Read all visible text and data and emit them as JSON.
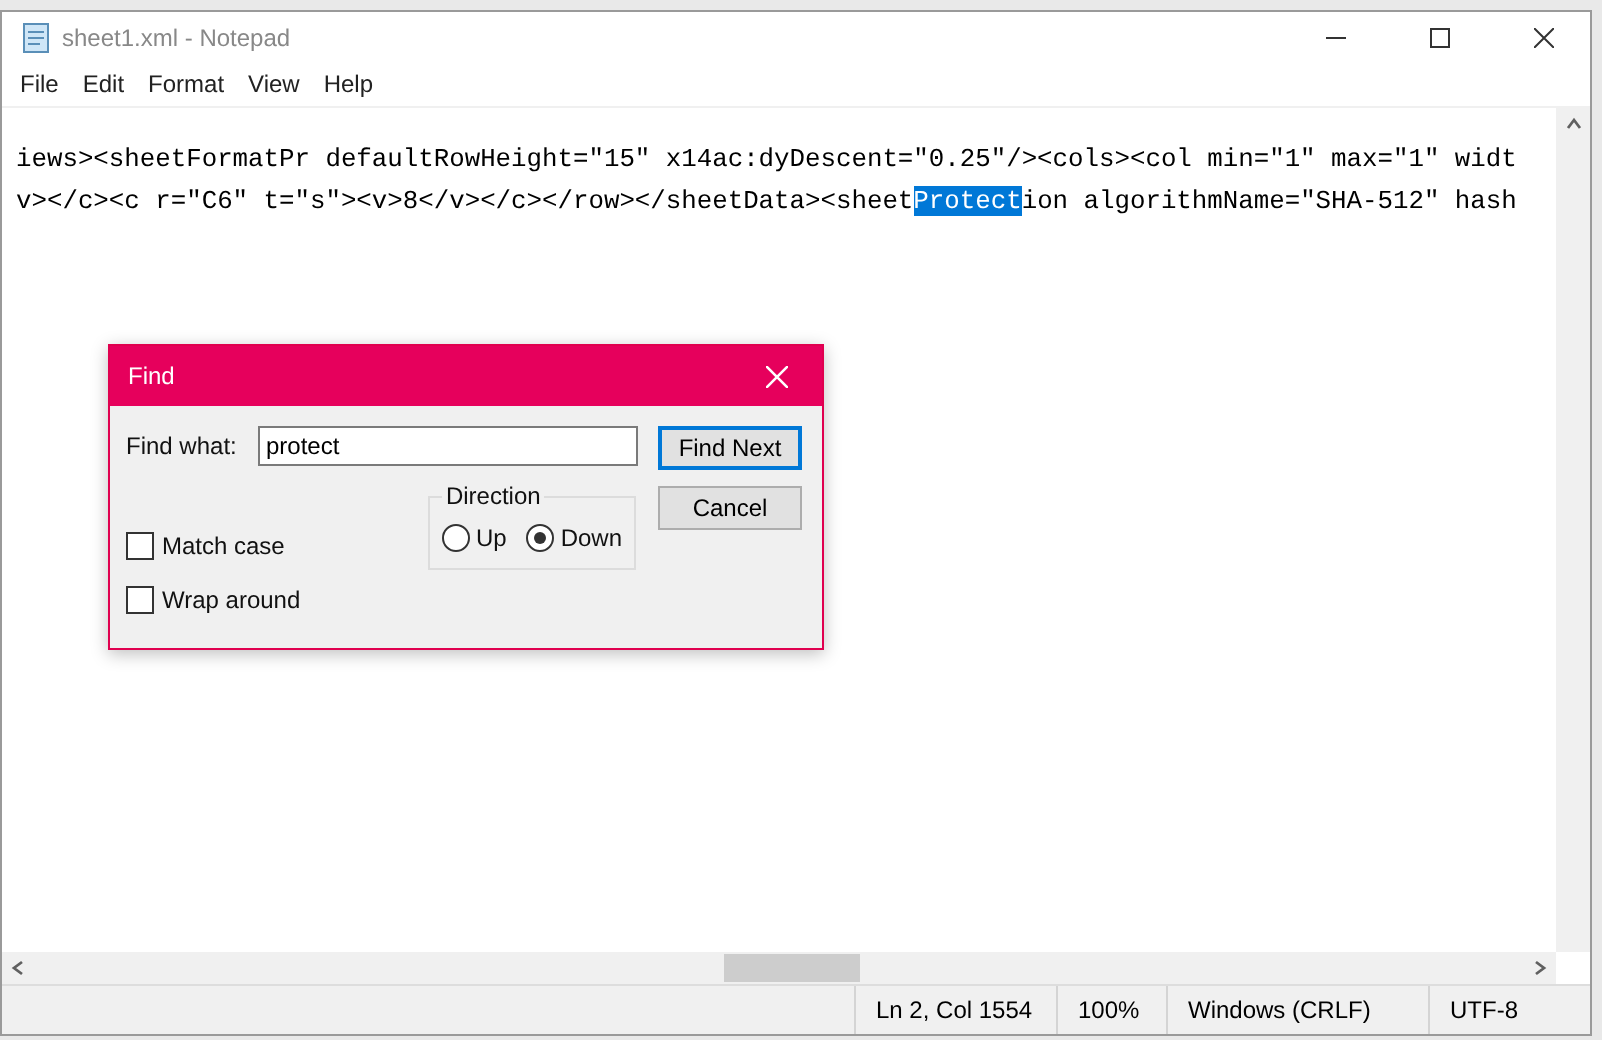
{
  "window": {
    "title": "sheet1.xml - Notepad"
  },
  "menu": [
    "File",
    "Edit",
    "Format",
    "View",
    "Help"
  ],
  "editor": {
    "lines": [
      {
        "segments": [
          {
            "text": "iews><sheetFormatPr defaultRowHeight=\"15\" x14ac:dyDescent=\"0.25\"/><cols><col min=\"1\" max=\"1\" widt",
            "selected": false
          }
        ]
      },
      {
        "segments": [
          {
            "text": "v></c><c r=\"C6\" t=\"s\"><v>8</v></c></row></sheetData><sheet",
            "selected": false
          },
          {
            "text": "Protect",
            "selected": true
          },
          {
            "text": "ion algorithmName=\"SHA-512\" hash",
            "selected": false
          }
        ]
      }
    ]
  },
  "find_dialog": {
    "title": "Find",
    "find_label": "Find what:",
    "find_value": "protect",
    "find_next": "Find Next",
    "cancel": "Cancel",
    "direction_label": "Direction",
    "direction": [
      {
        "label": "Up",
        "selected": false
      },
      {
        "label": "Down",
        "selected": true
      }
    ],
    "options": [
      {
        "label": "Match case",
        "checked": false
      },
      {
        "label": "Wrap around",
        "checked": false
      }
    ]
  },
  "status_bar": [
    "Ln 2, Col 1554",
    "100%",
    "Windows (CRLF)",
    "UTF-8"
  ]
}
